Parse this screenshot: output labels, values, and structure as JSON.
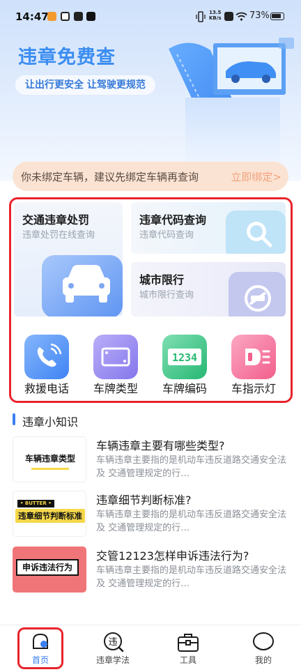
{
  "status_bar": {
    "time": "14:47",
    "net_speed_value": "13.5",
    "net_speed_unit": "KB/s",
    "battery": "73%"
  },
  "hero": {
    "title": "违章免费查",
    "slogan": "让出行更安全 让驾驶更规范"
  },
  "bind_banner": {
    "text": "你未绑定车辆，建议先绑定车辆再查询",
    "link": "立即绑定>"
  },
  "services": [
    {
      "title": "交通违章处罚",
      "subtitle": "违章处罚在线查询",
      "icon": "car-icon"
    },
    {
      "title": "违章代码查询",
      "subtitle": "违章代码查询",
      "icon": "magnifier-icon"
    },
    {
      "title": "城市限行",
      "subtitle": "城市限行查询",
      "icon": "no-car-icon"
    }
  ],
  "shortcuts": [
    {
      "label": "救援电话",
      "icon": "phone-icon",
      "color": "#4a8ff7"
    },
    {
      "label": "车牌类型",
      "icon": "license-plate-icon",
      "color": "#9a8af0"
    },
    {
      "label": "车牌编码",
      "icon": "plate-number-icon",
      "color": "#3dc789",
      "code": "1234"
    },
    {
      "label": "车指示灯",
      "icon": "indicator-light-icon",
      "color": "#f5709a"
    }
  ],
  "section": {
    "title": "违章小知识"
  },
  "articles": [
    {
      "title": "车辆违章主要有哪些类型?",
      "desc": "车辆违章主要指的是机动车违反道路交通安全法及 交通管理规定的行…",
      "thumb_text": "车辆违章类型"
    },
    {
      "title": "违章细节判断标准?",
      "desc": "车辆违章主要指的是机动车违反道路交通安全法及 交通管理规定的行…",
      "thumb_text": "违章细节判断标准",
      "thumb_tag": "• BUTTER •"
    },
    {
      "title": "交管12123怎样申诉违法行为?",
      "desc": "车辆违章主要指的是机动车违反道路交通安全法及 交通管理规定的行…",
      "thumb_text": "申诉违法行为"
    }
  ],
  "tabs": [
    {
      "label": "首页",
      "icon": "home-icon",
      "active": true
    },
    {
      "label": "违章学法",
      "icon": "violation-study-icon",
      "badge": "违"
    },
    {
      "label": "工具",
      "icon": "toolbox-icon"
    },
    {
      "label": "我的",
      "icon": "profile-icon"
    }
  ],
  "colors": {
    "accent": "#3b8df1",
    "highlight_frame": "#e8232c",
    "bind_link": "#f2a27c"
  }
}
